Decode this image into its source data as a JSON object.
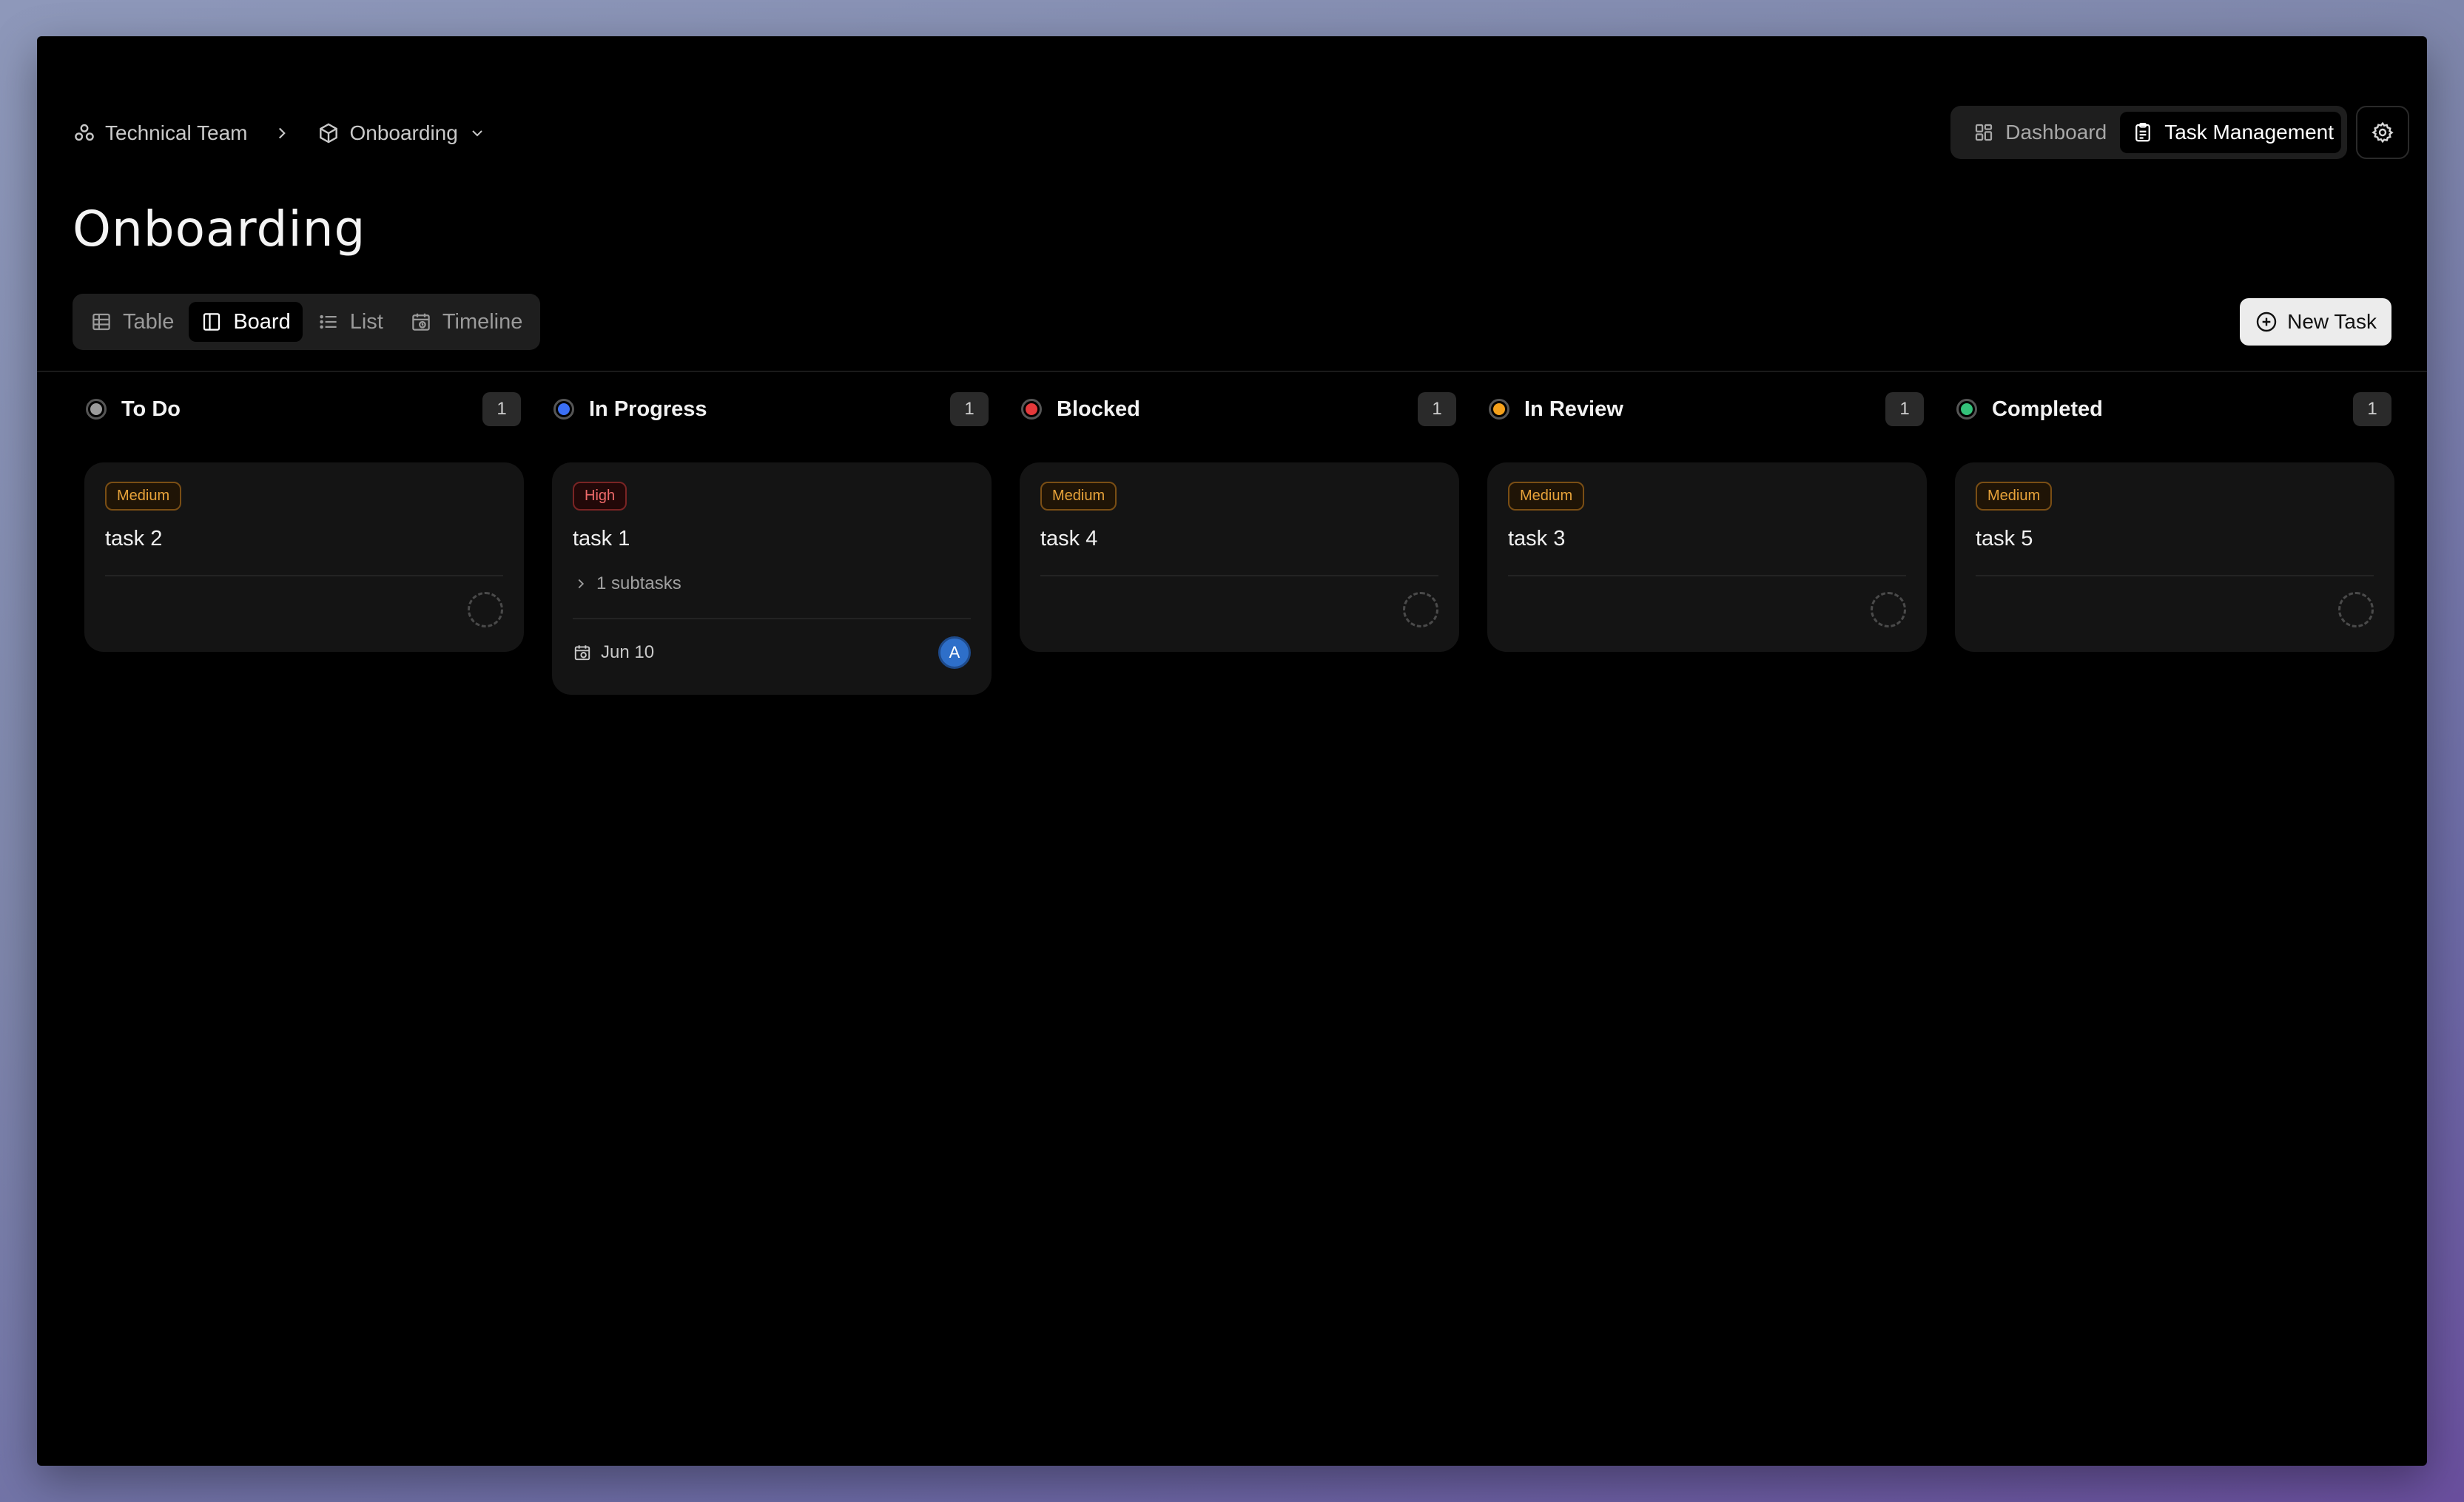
{
  "breadcrumb": {
    "team": "Technical Team",
    "project": "Onboarding",
    "team_icon": "team-icon",
    "project_icon": "cube-icon"
  },
  "top_nav": {
    "dashboard": "Dashboard",
    "task_management": "Task Management",
    "active": "Task Management"
  },
  "page": {
    "title": "Onboarding"
  },
  "view_tabs": {
    "items": [
      "Table",
      "Board",
      "List",
      "Timeline"
    ],
    "active": "Board"
  },
  "actions": {
    "new_task": "New Task"
  },
  "columns": [
    {
      "title": "To Do",
      "count": "1",
      "color": "#9a9a9a",
      "card": {
        "priority": "Medium",
        "title": "task 2"
      }
    },
    {
      "title": "In Progress",
      "count": "1",
      "color": "#3b6ff5",
      "card": {
        "priority": "High",
        "title": "task 1",
        "subtasks": "1 subtasks",
        "due": "Jun 10",
        "assignee": "A"
      }
    },
    {
      "title": "Blocked",
      "count": "1",
      "color": "#e5393b",
      "card": {
        "priority": "Medium",
        "title": "task 4"
      }
    },
    {
      "title": "In Review",
      "count": "1",
      "color": "#f5a11b",
      "card": {
        "priority": "Medium",
        "title": "task 3"
      }
    },
    {
      "title": "Completed",
      "count": "1",
      "color": "#34c27a",
      "card": {
        "priority": "Medium",
        "title": "task 5"
      }
    }
  ]
}
